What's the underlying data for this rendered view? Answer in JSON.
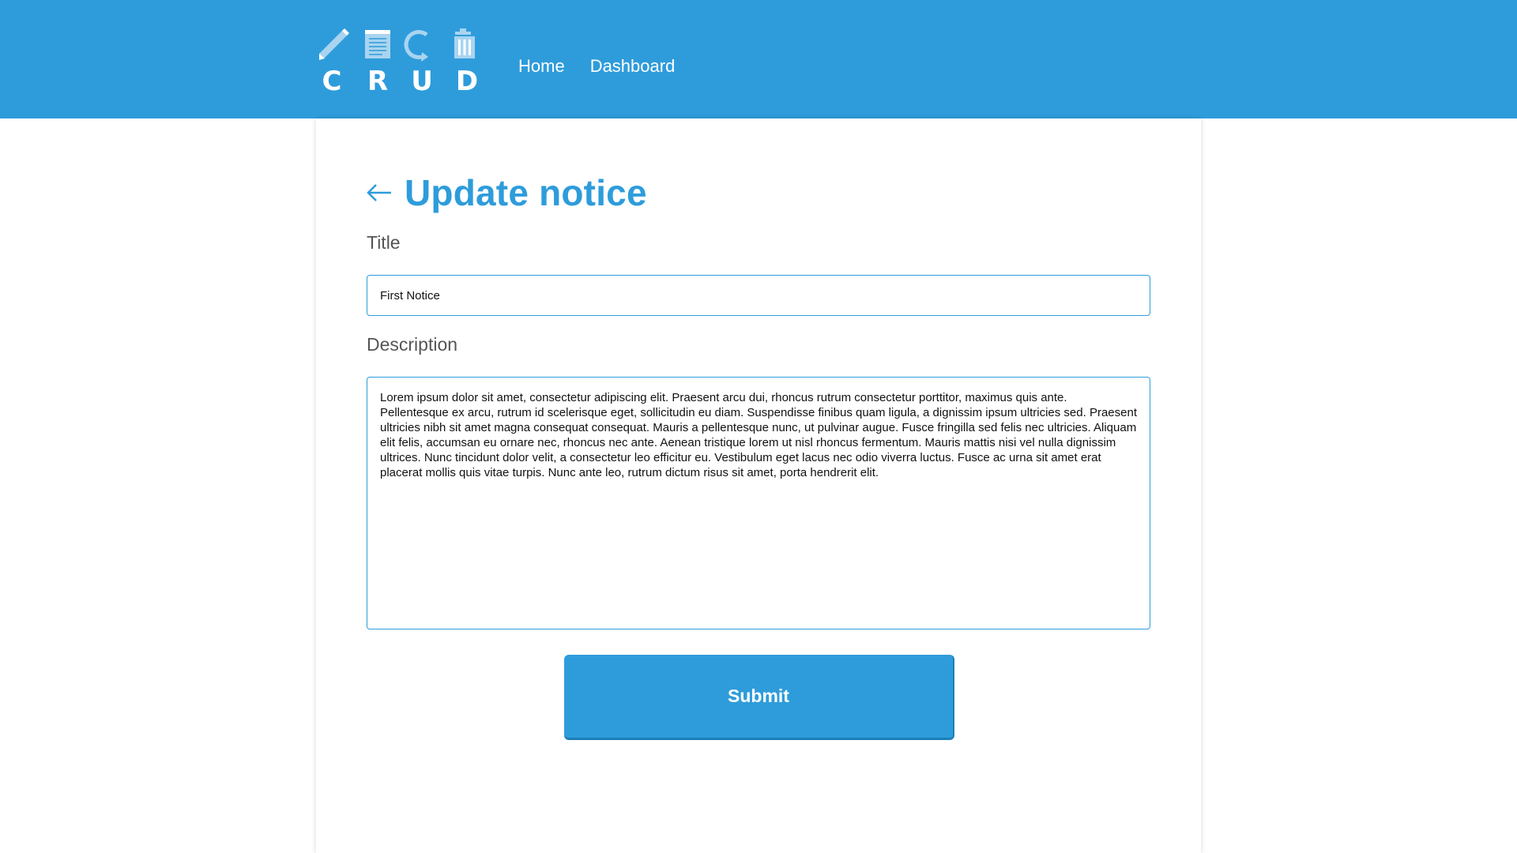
{
  "header": {
    "logo_letters": [
      "C",
      "R",
      "U",
      "D"
    ],
    "nav": [
      {
        "label": "Home"
      },
      {
        "label": "Dashboard"
      }
    ]
  },
  "form": {
    "title": "Update notice",
    "title_label": "Title",
    "title_value": "First Notice",
    "description_label": "Description",
    "description_value": "Lorem ipsum dolor sit amet, consectetur adipiscing elit. Praesent arcu dui, rhoncus rutrum consectetur porttitor, maximus quis ante. Pellentesque ex arcu, rutrum id scelerisque eget, sollicitudin eu diam. Suspendisse finibus quam ligula, a dignissim ipsum ultricies sed. Praesent ultricies nibh sit amet magna consequat consequat. Mauris a pellentesque nunc, ut pulvinar augue. Fusce fringilla sed felis nec ultricies. Aliquam elit felis, accumsan eu ornare nec, rhoncus nec ante. Aenean tristique lorem ut nisl rhoncus fermentum. Mauris mattis nisi vel nulla dignissim ultrices. Nunc tincidunt dolor velit, a consectetur leo efficitur eu. Vestibulum eget lacus nec odio viverra luctus. Fusce ac urna sit amet erat placerat mollis quis vitae turpis. Nunc ante leo, rutrum dictum risus sit amet, porta hendrerit elit.",
    "submit_label": "Submit"
  },
  "colors": {
    "brand": "#2e9cdb",
    "logo_icon": "#a9d4f0",
    "label_text": "#555555"
  },
  "icons": [
    "pencil-icon",
    "notepad-icon",
    "refresh-icon",
    "trash-icon",
    "arrow-left-icon"
  ]
}
